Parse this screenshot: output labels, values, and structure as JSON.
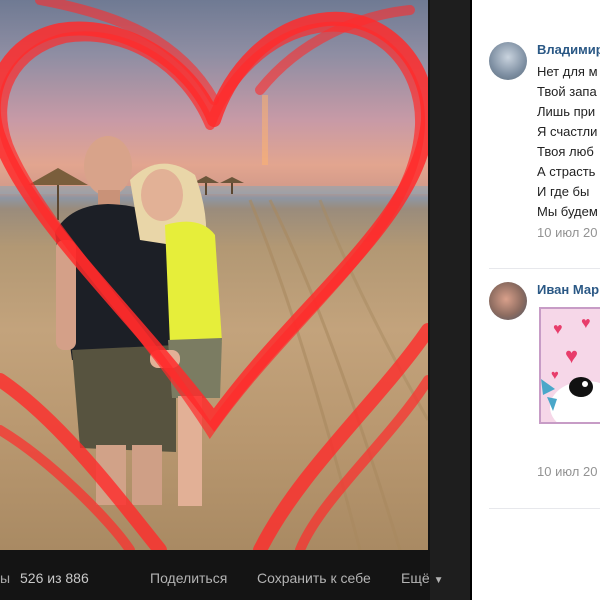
{
  "viewer": {
    "counter_prefix": "ы",
    "counter": "526 из 886",
    "share_label": "Поделиться",
    "save_label": "Сохранить к себе",
    "more_label": "Ещё",
    "more_icon": "chevron-down-icon"
  },
  "comments": [
    {
      "author": "Владимир",
      "lines": [
        "Нет для м",
        "Твой запа",
        "Лишь при",
        "Я счастли",
        "Твоя люб",
        "А страсть",
        "И где бы",
        "Мы будем"
      ],
      "date": "10 июл 20"
    },
    {
      "author": "Иван Мар",
      "sticker": "heart-sticker",
      "date": "10 июл 20"
    }
  ],
  "colors": {
    "link": "#2a5885",
    "heart_scribble": "#ff2b2b"
  }
}
